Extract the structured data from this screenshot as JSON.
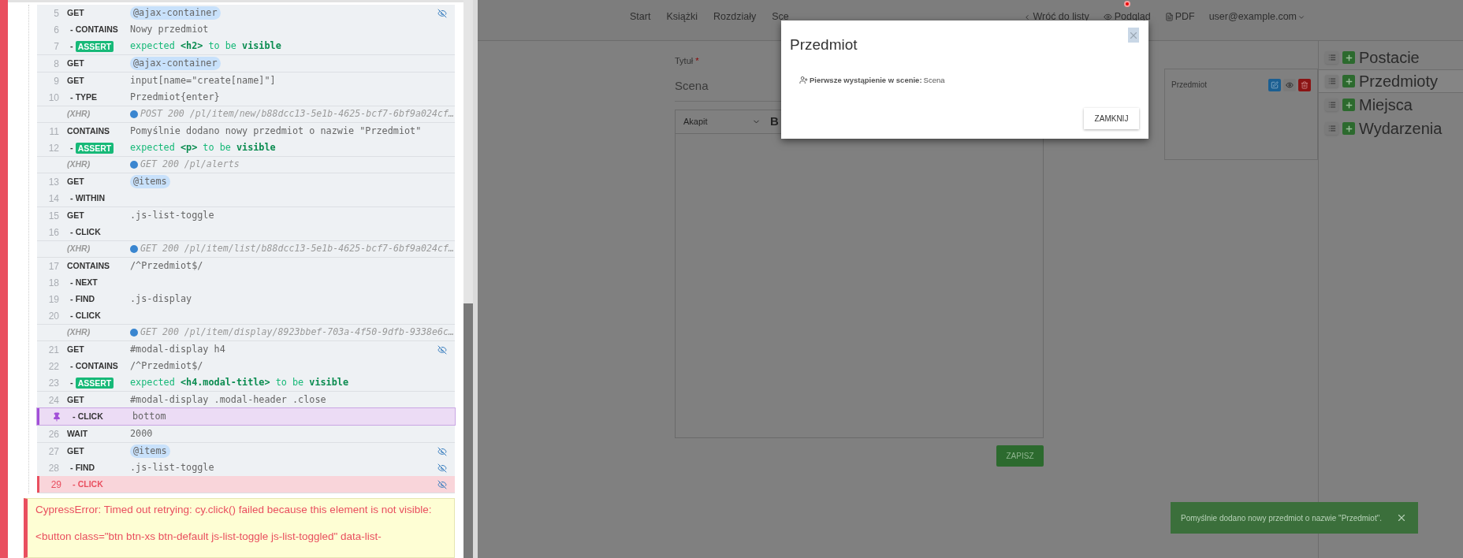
{
  "runner": {
    "groups": [
      {
        "kind": "commands",
        "commands": [
          {
            "number": "5",
            "name": "GET",
            "kind": "alias",
            "message": "@ajax-container",
            "pinned": false,
            "failed": false,
            "eye": true
          },
          {
            "number": "6",
            "dash": "-",
            "name": "CONTAINS",
            "kind": "text",
            "message": "Nowy przedmiot",
            "pinned": false,
            "failed": false,
            "eye": false
          },
          {
            "number": "7",
            "dash": "-",
            "name": "ASSERT",
            "kind": "assert",
            "message": "expected **<h2>** to be **visible**",
            "pinned": false,
            "failed": false,
            "eye": false
          }
        ]
      },
      {
        "kind": "commands",
        "commands": [
          {
            "number": "8",
            "name": "GET",
            "kind": "alias",
            "message": "@ajax-container",
            "pinned": false,
            "failed": false,
            "eye": false
          }
        ]
      },
      {
        "kind": "commands",
        "commands": [
          {
            "number": "9",
            "name": "GET",
            "kind": "text",
            "message": "input[name=\"create[name]\"]",
            "pinned": false,
            "failed": false,
            "eye": false
          },
          {
            "number": "10",
            "dash": "-",
            "name": "TYPE",
            "kind": "text",
            "message": "Przedmiot{enter}",
            "pinned": false,
            "failed": false,
            "eye": false
          }
        ]
      },
      {
        "kind": "xhr",
        "name": "(XHR)",
        "message": "POST 200 /pl/item/new/b88dcc13-5e1b-4625-bcf7-6bf9a024cf…"
      },
      {
        "kind": "commands",
        "commands": [
          {
            "number": "11",
            "name": "CONTAINS",
            "kind": "text",
            "message": "Pomyślnie dodano nowy przedmiot o nazwie \"Przedmiot\"",
            "pinned": false,
            "failed": false,
            "eye": false
          },
          {
            "number": "12",
            "dash": "-",
            "name": "ASSERT",
            "kind": "assert",
            "message": "expected **<p>** to be **visible**",
            "pinned": false,
            "failed": false,
            "eye": false
          }
        ]
      },
      {
        "kind": "xhr",
        "name": "(XHR)",
        "message": "GET 200 /pl/alerts"
      },
      {
        "kind": "commands",
        "commands": [
          {
            "number": "13",
            "name": "GET",
            "kind": "alias",
            "message": "@items",
            "pinned": false,
            "failed": false,
            "eye": false
          },
          {
            "number": "14",
            "dash": "-",
            "name": "WITHIN",
            "kind": "text",
            "pinned": false,
            "failed": false,
            "eye": false
          }
        ]
      },
      {
        "kind": "commands",
        "commands": [
          {
            "number": "15",
            "name": "GET",
            "kind": "text",
            "message": ".js-list-toggle",
            "pinned": false,
            "failed": false,
            "eye": false
          },
          {
            "number": "16",
            "dash": "-",
            "name": "CLICK",
            "kind": "text",
            "pinned": false,
            "failed": false,
            "eye": false
          }
        ]
      },
      {
        "kind": "xhr",
        "name": "(XHR)",
        "message": "GET 200 /pl/item/list/b88dcc13-5e1b-4625-bcf7-6bf9a024cf…"
      },
      {
        "kind": "commands",
        "commands": [
          {
            "number": "17",
            "name": "CONTAINS",
            "kind": "text",
            "message": "/^Przedmiot$/",
            "pinned": false,
            "failed": false,
            "eye": false
          },
          {
            "number": "18",
            "dash": "-",
            "name": "NEXT",
            "kind": "text",
            "pinned": false,
            "failed": false,
            "eye": false
          },
          {
            "number": "19",
            "dash": "-",
            "name": "FIND",
            "kind": "text",
            "message": ".js-display",
            "pinned": false,
            "failed": false,
            "eye": false
          },
          {
            "number": "20",
            "dash": "-",
            "name": "CLICK",
            "kind": "text",
            "pinned": false,
            "failed": false,
            "eye": false
          }
        ]
      },
      {
        "kind": "xhr",
        "name": "(XHR)",
        "message": "GET 200 /pl/item/display/8923bbef-703a-4f50-9dfb-9338e6c…"
      },
      {
        "kind": "commands",
        "commands": [
          {
            "number": "21",
            "name": "GET",
            "kind": "text",
            "message": "#modal-display h4",
            "pinned": false,
            "failed": false,
            "eye": true
          },
          {
            "number": "22",
            "dash": "-",
            "name": "CONTAINS",
            "kind": "text",
            "message": "/^Przedmiot$/",
            "pinned": false,
            "failed": false,
            "eye": false
          },
          {
            "number": "23",
            "dash": "-",
            "name": "ASSERT",
            "kind": "assert",
            "message": "expected **<h4.modal-title>** to be **visible**",
            "pinned": false,
            "failed": false,
            "eye": false
          }
        ]
      },
      {
        "kind": "commands",
        "commands": [
          {
            "number": "24",
            "name": "GET",
            "kind": "text",
            "message": "#modal-display .modal-header .close",
            "pinned": false,
            "failed": false,
            "eye": false
          },
          {
            "dash": "-",
            "name": "CLICK",
            "kind": "text",
            "message": "bottom",
            "pinned": true,
            "failed": false,
            "eye": false
          }
        ]
      },
      {
        "kind": "commands",
        "commands": [
          {
            "number": "26",
            "name": "WAIT",
            "kind": "text",
            "message": "2000",
            "pinned": false,
            "failed": false,
            "eye": false
          }
        ]
      },
      {
        "kind": "commands",
        "commands": [
          {
            "number": "27",
            "name": "GET",
            "kind": "alias",
            "message": "@items",
            "pinned": false,
            "failed": false,
            "eye": true
          },
          {
            "number": "28",
            "dash": "-",
            "name": "FIND",
            "kind": "text",
            "message": ".js-list-toggle",
            "pinned": false,
            "failed": false,
            "eye": true
          },
          {
            "number": "29",
            "dash": "-",
            "name": "CLICK",
            "kind": "text",
            "pinned": false,
            "failed": true,
            "eye": true
          }
        ]
      }
    ],
    "error": {
      "paragraphs": [
        "CypressError: Timed out retrying: cy.click() failed because this element is not visible:",
        "<button class=\"btn btn-xs btn-default js-list-toggle js-list-toggled\" data-list-"
      ]
    }
  },
  "app": {
    "nav": {
      "links": [
        "Start",
        "Książki",
        "Rozdziały",
        "Sce"
      ],
      "back": "Wróć do listy",
      "preview": {
        "label": "Podgląd",
        "badge": true
      },
      "pdf": "PDF",
      "user": "user@example.com"
    },
    "form": {
      "title_label": "Tytuł",
      "required_mark": "*",
      "title_value": "Scena",
      "editor_style": "Akapit",
      "bold_button": "B",
      "save": "ZAPISZ"
    },
    "item_card": {
      "name": "Przedmiot"
    },
    "sidebar": {
      "items": [
        {
          "label": "Postacie",
          "selected": false
        },
        {
          "label": "Przedmioty",
          "selected": true
        },
        {
          "label": "Miejsca",
          "selected": false
        },
        {
          "label": "Wydarzenia",
          "selected": false
        }
      ]
    },
    "toast": {
      "message": "Pomyślnie dodano nowy przedmiot o nazwie \"Przedmiot\"."
    }
  },
  "modal": {
    "title": "Przedmiot",
    "label": "Pierwsze wystąpienie w scenie:",
    "value": "Scena",
    "close_button": "ZAMKNIJ"
  }
}
